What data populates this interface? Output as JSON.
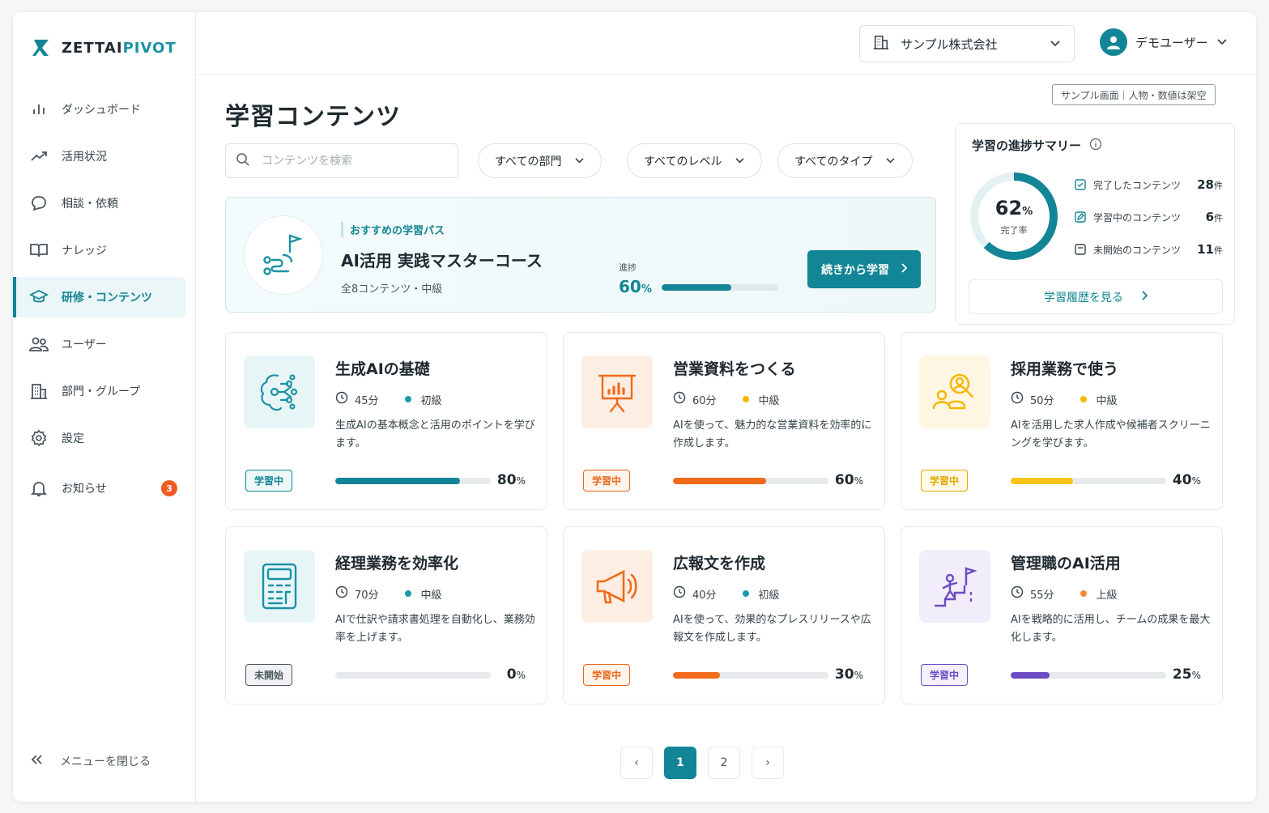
{
  "brand": {
    "name_prefix": "ZETTAI",
    "name_suffix": "PIVOT",
    "accent": "#128596"
  },
  "sidebar": {
    "items": [
      {
        "label": "ダッシュボード",
        "icon": "bar-chart-icon"
      },
      {
        "label": "活用状況",
        "icon": "trend-line-icon"
      },
      {
        "label": "相談・依頼",
        "icon": "chat-bubble-icon"
      },
      {
        "label": "ナレッジ",
        "icon": "book-icon"
      },
      {
        "label": "研修・コンテンツ",
        "icon": "graduation-cap-icon",
        "active": true
      },
      {
        "label": "ユーザー",
        "icon": "users-icon"
      },
      {
        "label": "部門・グループ",
        "icon": "building-icon"
      },
      {
        "label": "設定",
        "icon": "gear-icon"
      },
      {
        "label": "お知らせ",
        "icon": "bell-icon",
        "badge": "3"
      }
    ],
    "collapse_label": "メニューを閉じる"
  },
  "topbar": {
    "company": "サンプル株式会社",
    "user": "デモユーザー"
  },
  "main": {
    "sample_notice": "サンプル画面｜人物・数値は架空",
    "title": "学習コンテンツ",
    "search_placeholder": "コンテンツを検索",
    "filters": [
      "すべての部門",
      "すべてのレベル",
      "すべてのタイプ"
    ],
    "recommended": {
      "label": "おすすめの学習パス",
      "title": "AI活用 実践マスターコース",
      "meta": "全8コンテンツ・中級",
      "progress_label": "進捗",
      "progress_value": "60",
      "progress_unit": "%",
      "progress_fraction": 0.6,
      "button": "続きから学習"
    },
    "summary": {
      "title": "学習の進捗サマリー",
      "rate_value": "62",
      "rate_unit": "%",
      "rate_label": "完了率",
      "rate_fraction": 0.62,
      "stats": [
        {
          "label": "完了したコンテンツ",
          "count": "28",
          "unit": "件"
        },
        {
          "label": "学習中のコンテンツ",
          "count": "6",
          "unit": "件"
        },
        {
          "label": "未開始のコンテンツ",
          "count": "11",
          "unit": "件"
        }
      ],
      "history_button": "学習履歴を見る"
    },
    "cards": [
      {
        "title": "生成AIの基礎",
        "duration": "45分",
        "level": "初級",
        "level_color": "#1a9aab",
        "desc": "生成AIの基本概念と活用のポイントを学びます。",
        "status": "学習中",
        "status_color": "#128596",
        "status_bg": "#eef8f9",
        "pct": "80",
        "pct_unit": "%",
        "fraction": 0.8,
        "bar_color": "#128596",
        "icon": "ai-brain-icon",
        "icon_bg": "#e8f5f6"
      },
      {
        "title": "営業資料をつくる",
        "duration": "60分",
        "level": "中級",
        "level_color": "#f5b800",
        "desc": "AIを使って、魅力的な営業資料を効率的に作成します。",
        "status": "学習中",
        "status_color": "#e8681c",
        "status_bg": "#fff4ec",
        "pct": "60",
        "pct_unit": "%",
        "fraction": 0.6,
        "bar_color": "#f26a1b",
        "icon": "presentation-chart-icon",
        "icon_bg": "#fdeee4"
      },
      {
        "title": "採用業務で使う",
        "duration": "50分",
        "level": "中級",
        "level_color": "#f5b800",
        "desc": "AIを活用した求人作成や候補者スクリーニングを学びます。",
        "status": "学習中",
        "status_color": "#e0a800",
        "status_bg": "#fff9e6",
        "pct": "40",
        "pct_unit": "%",
        "fraction": 0.4,
        "bar_color": "#f7c315",
        "icon": "recruit-search-icon",
        "icon_bg": "#fef6e2"
      },
      {
        "title": "経理業務を効率化",
        "duration": "70分",
        "level": "中級",
        "level_color": "#1a9aab",
        "desc": "AIで仕訳や請求書処理を自動化し、業務効率を上げます。",
        "status": "未開始",
        "status_color": "#4a565c",
        "status_bg": "#f0f2f3",
        "pct": "0",
        "pct_unit": "%",
        "fraction": 0,
        "bar_color": "#128596",
        "icon": "calculator-icon",
        "icon_bg": "#e8f5f6"
      },
      {
        "title": "広報文を作成",
        "duration": "40分",
        "level": "初級",
        "level_color": "#1a9aab",
        "desc": "AIを使って、効果的なプレスリリースや広報文を作成します。",
        "status": "学習中",
        "status_color": "#e8681c",
        "status_bg": "#fff4ec",
        "pct": "30",
        "pct_unit": "%",
        "fraction": 0.3,
        "bar_color": "#f26a1b",
        "icon": "megaphone-icon",
        "icon_bg": "#fdeee4"
      },
      {
        "title": "管理職のAI活用",
        "duration": "55分",
        "level": "上級",
        "level_color": "#f08a3c",
        "desc": "AIを戦略的に活用し、チームの成果を最大化します。",
        "status": "学習中",
        "status_color": "#6b4cc2",
        "status_bg": "#f4f0fc",
        "pct": "25",
        "pct_unit": "%",
        "fraction": 0.25,
        "bar_color": "#6b4cc2",
        "icon": "leader-climb-icon",
        "icon_bg": "#f1edfa"
      }
    ],
    "pagination": {
      "prev": "‹",
      "pages": [
        "1",
        "2"
      ],
      "current": "1",
      "next": "›"
    }
  }
}
